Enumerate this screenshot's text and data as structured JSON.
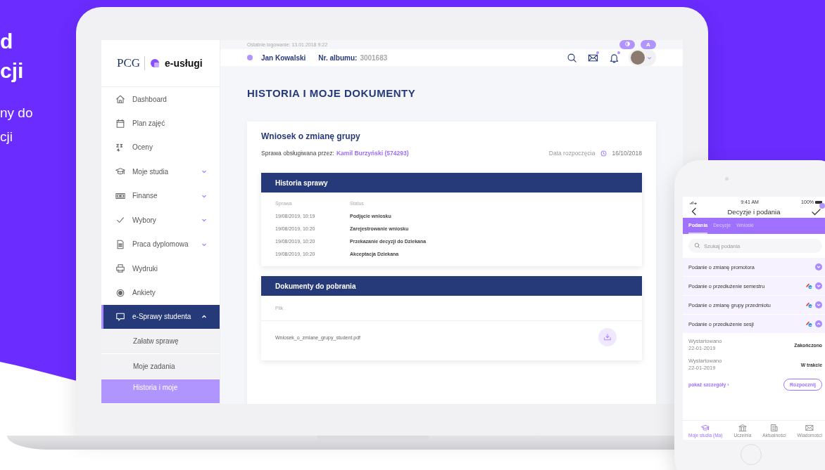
{
  "promo": {
    "headline": [
      "d",
      "cji"
    ],
    "subtitle": [
      "ny do",
      "cji"
    ]
  },
  "laptop": {
    "sidebar": {
      "logo": {
        "company": "PCG",
        "product": "e-usługi"
      },
      "items": [
        {
          "label": "Dashboard",
          "kind": "home",
          "expandable": false,
          "selected": false,
          "expanded": false
        },
        {
          "label": "Plan zajęć",
          "kind": "calendar",
          "expandable": false,
          "selected": false,
          "expanded": false
        },
        {
          "label": "Oceny",
          "kind": "grades",
          "expandable": false,
          "selected": false,
          "expanded": false
        },
        {
          "label": "Moje studia",
          "kind": "cap",
          "expandable": true,
          "selected": false,
          "expanded": false
        },
        {
          "label": "Finanse",
          "kind": "money",
          "expandable": true,
          "selected": false,
          "expanded": false
        },
        {
          "label": "Wybory",
          "kind": "check",
          "expandable": true,
          "selected": false,
          "expanded": false
        },
        {
          "label": "Praca dyplomowa",
          "kind": "document",
          "expandable": true,
          "selected": false,
          "expanded": false
        },
        {
          "label": "Wydruki",
          "kind": "printer",
          "expandable": false,
          "selected": false,
          "expanded": false
        },
        {
          "label": "Ankiety",
          "kind": "radio",
          "expandable": false,
          "selected": false,
          "expanded": false
        },
        {
          "label": "e-Sprawy studenta",
          "kind": "chat",
          "expandable": true,
          "selected": true,
          "expanded": true,
          "children": [
            {
              "label": "Załatw sprawę",
              "selected": false
            },
            {
              "label": "Moje zadania",
              "selected": false
            },
            {
              "label": "Historia i moje",
              "selected": true
            }
          ]
        }
      ]
    },
    "top_bar": {
      "last_login": "Ostatnie logowanie: 13.01.2018 9:22",
      "font_button": "A"
    },
    "header": {
      "user": "Jan Kowalski",
      "album_label": "Nr. albumu:",
      "album_number": "3001683",
      "icons": [
        {
          "kind": "search",
          "unread": false
        },
        {
          "kind": "mail",
          "unread": true
        },
        {
          "kind": "bell",
          "unread": true
        }
      ]
    },
    "page_title": "HISTORIA I MOJE DOKUMENTY",
    "case": {
      "title": "Wniosek o zmianę grupy",
      "handled_by_label": "Sprawa obsługiwana przez:",
      "handled_by": "Kamil Burzyński (574293)",
      "start_label": "Data rozpoczęcia",
      "start_date": "16/10/2018"
    },
    "history": {
      "title": "Historia sprawy",
      "columns": [
        "Sprawa",
        "Status"
      ],
      "rows": [
        [
          "19/08/2019, 10:19",
          "Podjęcie wniosku"
        ],
        [
          "19/08/2019, 10:20",
          "Zarejestrowanie wniosku"
        ],
        [
          "19/08/2019, 10:20",
          "Przekazanie decyzji do Dziekana"
        ],
        [
          "19/08/2019, 10:20",
          "Akceptacja Dziekana"
        ]
      ]
    },
    "documents": {
      "title": "Dokumenty do pobrania",
      "columns": [
        "Plik"
      ],
      "rows": [
        {
          "file": "Wniosek_o_zmiane_grupy_student.pdf"
        }
      ]
    }
  },
  "phone": {
    "status_bar": {
      "time": "9:41 AM",
      "battery": "100%"
    },
    "title": "Decyzje i podania",
    "tabs": [
      {
        "label": "Podania",
        "selected": true
      },
      {
        "label": "Decyzje",
        "selected": false
      },
      {
        "label": "Wnioski",
        "selected": false
      }
    ],
    "search": {
      "placeholder": "Szukaj podania"
    },
    "items": [
      {
        "label": "Podanie o zmianę promotora",
        "e_icon": false,
        "expanded": false
      },
      {
        "label": "Podanie o przedłużenie semestru",
        "e_icon": true,
        "expanded": false
      },
      {
        "label": "Podanie o zmianę grupy przedmiotu",
        "e_icon": true,
        "expanded": false
      },
      {
        "label": "Podanie o przedłużenie sesji",
        "e_icon": true,
        "expanded": true
      }
    ],
    "details": [
      {
        "label": "Wystartowano",
        "date": "22-01-2019",
        "status": "Zakończono"
      },
      {
        "label": "Wystartowano",
        "date": "22-01-2019",
        "status": "W trakcie"
      }
    ],
    "details_link": "pokaż szczegóły ›",
    "start_button": "Rozpocznij",
    "nav": [
      {
        "label": "Moje studia (Ma)",
        "kind": "cap",
        "selected": true
      },
      {
        "label": "Uczelnia",
        "kind": "bank",
        "selected": false
      },
      {
        "label": "Aktualności",
        "kind": "news",
        "selected": false
      },
      {
        "label": "Wiadomości",
        "kind": "mail",
        "selected": false
      }
    ]
  }
}
